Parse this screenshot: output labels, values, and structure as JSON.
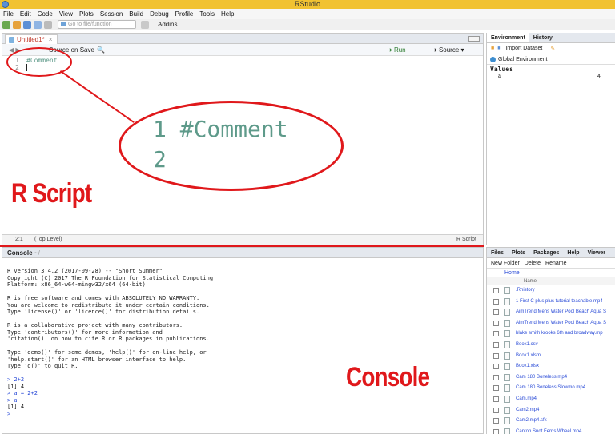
{
  "window": {
    "title": "RStudio"
  },
  "menu": [
    "File",
    "Edit",
    "Code",
    "View",
    "Plots",
    "Session",
    "Build",
    "Debug",
    "Profile",
    "Tools",
    "Help"
  ],
  "toolbar": {
    "goto_placeholder": "Go to file/function",
    "addins_label": "Addins"
  },
  "source": {
    "tab_label": "Untitled1*",
    "source_on_save": "Source on Save",
    "run_label": "Run",
    "source_label": "Source",
    "lines": [
      "1",
      "2"
    ],
    "code": [
      "#Comment",
      ""
    ],
    "status_position": "2:1",
    "status_scope": "(Top Level)",
    "status_type": "R Script"
  },
  "console": {
    "tab_label": "Console",
    "path": "~/",
    "output": [
      "R version 3.4.2 (2017-09-28) -- \"Short Summer\"",
      "Copyright (C) 2017 The R Foundation for Statistical Computing",
      "Platform: x86_64-w64-mingw32/x64 (64-bit)",
      "",
      "R is free software and comes with ABSOLUTELY NO WARRANTY.",
      "You are welcome to redistribute it under certain conditions.",
      "Type 'license()' or 'licence()' for distribution details.",
      "",
      "R is a collaborative project with many contributors.",
      "Type 'contributors()' for more information and",
      "'citation()' on how to cite R or R packages in publications.",
      "",
      "Type 'demo()' for some demos, 'help()' for on-line help, or",
      "'help.start()' for an HTML browser interface to help.",
      "Type 'q()' to quit R.",
      ""
    ],
    "session": [
      {
        "text": "> 2+2",
        "cmd": true
      },
      {
        "text": "[1] 4",
        "cmd": false
      },
      {
        "text": "> a = 2+2",
        "cmd": true
      },
      {
        "text": "> a",
        "cmd": true
      },
      {
        "text": "[1] 4",
        "cmd": false
      },
      {
        "text": "> ",
        "cmd": true
      }
    ]
  },
  "environment": {
    "tabs": [
      "Environment",
      "History"
    ],
    "import_label": "Import Dataset",
    "scope_label": "Global Environment",
    "section": "Values",
    "vars": [
      {
        "name": "a",
        "value": "4"
      }
    ]
  },
  "files": {
    "tabs": [
      "Files",
      "Plots",
      "Packages",
      "Help",
      "Viewer"
    ],
    "new_folder": "New Folder",
    "delete": "Delete",
    "rename": "Rename",
    "home": "Home",
    "name_header": "Name",
    "items": [
      ".Rhistory",
      "1 First C plus plus tutorial teachable.mp4",
      "AimTrend Mens Water Pool Beach Aqua S",
      "AimTrend Mens Water Pool Beach Aqua S",
      "blake smith krooks 6th and broadway.mp",
      "Book1.csv",
      "Book1.xlsm",
      "Book1.xlsx",
      "Cam 180 Boneless.mp4",
      "Cam 180 Boneless Slowmo.mp4",
      "Cam.mp4",
      "Cam2.mp4",
      "Cam2.mp4.sfk",
      "Canton Snot Ferris Wheel.mp4"
    ]
  },
  "annotations": {
    "zoom_line1": "1 #Comment",
    "zoom_line2": "2",
    "rscript_label": "R Script",
    "console_label": "Console"
  },
  "colors": {
    "accent_red": "#e0181b",
    "comment_green": "#5e9a8a",
    "title_bar": "#f1c232"
  }
}
